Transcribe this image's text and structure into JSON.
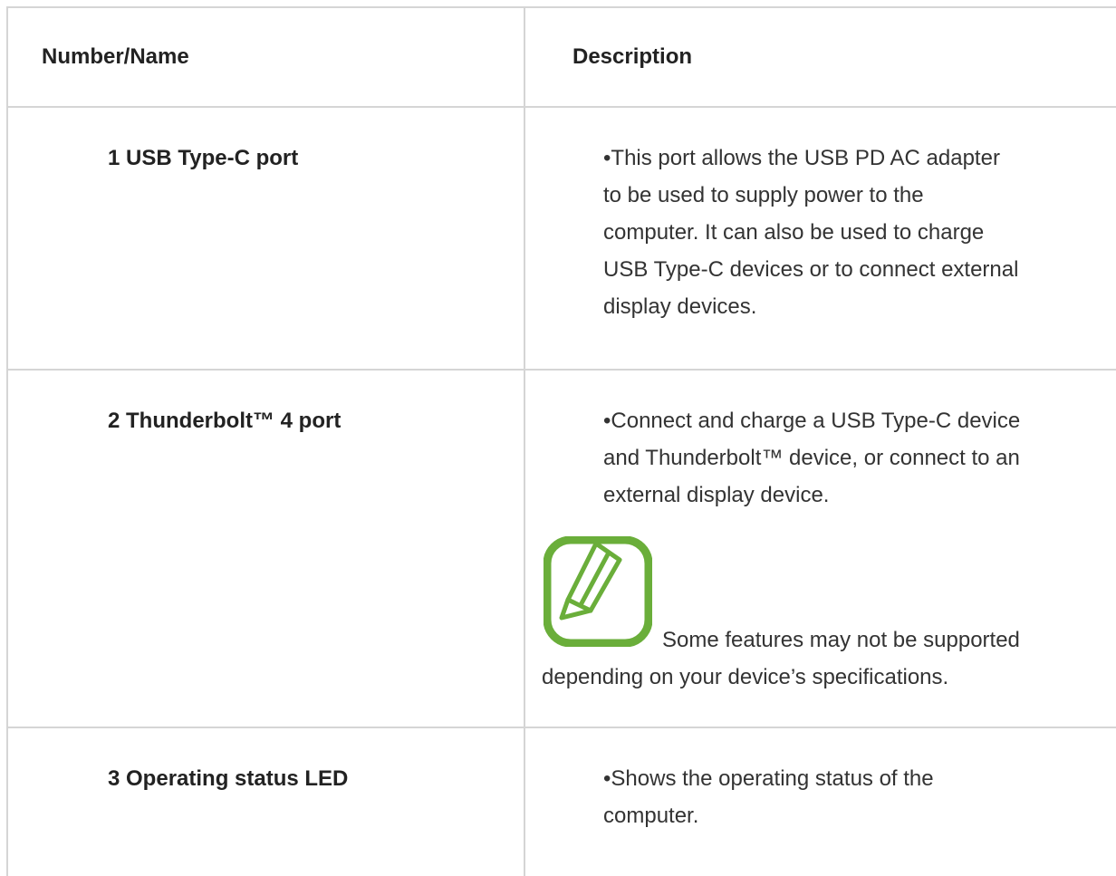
{
  "table": {
    "headers": {
      "col1": "Number/Name",
      "col2": "Description"
    },
    "rows": [
      {
        "name": "1 USB Type-C port",
        "description_lines": [
          "•This port allows the USB PD AC adapter",
          "to be used to supply power to the",
          "computer. It can also be used to charge",
          "USB Type-C devices or to connect external",
          "display devices."
        ]
      },
      {
        "name": "2 Thunderbolt™ 4 port",
        "description_lines": [
          "•Connect and charge a USB Type-C device",
          "and Thunderbolt™ device, or connect to an",
          "external display device."
        ],
        "note": {
          "icon": "note-pencil-icon",
          "icon_color": "#6aae3a",
          "lines": [
            "Some features may not be supported",
            "depending on your device’s specifications."
          ]
        }
      },
      {
        "name": "3 Operating status LED",
        "description_lines": [
          "•Shows the operating status of the",
          "computer."
        ]
      }
    ]
  }
}
